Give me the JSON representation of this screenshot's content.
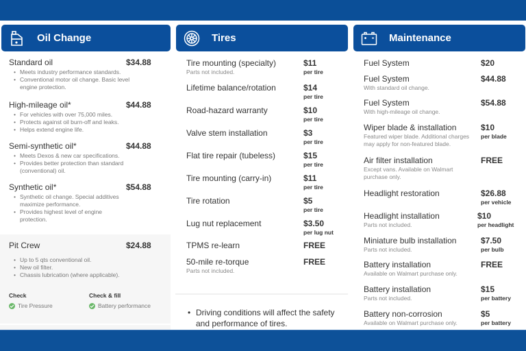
{
  "colors": {
    "brand": "#0b4f9c",
    "check": "#6bb86a"
  },
  "oil": {
    "title": "Oil Change",
    "icon": "oil-can-icon",
    "items": [
      {
        "name": "Standard oil",
        "price": "$34.88",
        "bullets": [
          "Meets industry performance standards.",
          "Conventional motor oil change. Basic level engine protection."
        ]
      },
      {
        "name": "High-mileage oil*",
        "price": "$44.88",
        "bullets": [
          "For vehicles with over 75,000 miles.",
          "Protects against oil burn-off and leaks.",
          "Helps extend engine life."
        ]
      },
      {
        "name": "Semi-synthetic oil*",
        "price": "$44.88",
        "bullets": [
          "Meets Dexos & new car specifications.",
          "Provides better protection than standard (conventional) oil."
        ]
      },
      {
        "name": "Synthetic oil*",
        "price": "$54.88",
        "bullets": [
          "Synthetic oil change. Special additives maximize performance.",
          "Provides highest level of engine protection."
        ]
      }
    ],
    "pit_crew": {
      "name": "Pit Crew",
      "price": "$24.88",
      "bullets": [
        "Up to 5 qts conventional oil.",
        "New oil filter.",
        "Chassis lubrication (where applicable)."
      ],
      "check_title": "Check",
      "check_item": "Tire Pressure",
      "fill_title": "Check & fill",
      "fill_item": "Battery performance"
    }
  },
  "tires": {
    "title": "Tires",
    "icon": "tire-icon",
    "items": [
      {
        "name": "Tire mounting (specialty)",
        "note": "Parts not included.",
        "price": "$11",
        "unit": "per tire"
      },
      {
        "name": "Lifetime balance/rotation",
        "note": "",
        "price": "$14",
        "unit": "per tire"
      },
      {
        "name": "Road-hazard warranty",
        "note": "",
        "price": "$10",
        "unit": "per tire"
      },
      {
        "name": "Valve stem installation",
        "note": "",
        "price": "$3",
        "unit": "per tire"
      },
      {
        "name": "Flat tire repair (tubeless)",
        "note": "",
        "price": "$15",
        "unit": "per tire"
      },
      {
        "name": "Tire mounting (carry-in)",
        "note": "",
        "price": "$11",
        "unit": "per tire"
      },
      {
        "name": "Tire rotation",
        "note": "",
        "price": "$5",
        "unit": "per tire"
      },
      {
        "name": "Lug nut replacement",
        "note": "",
        "price": "$3.50",
        "unit": "per lug nut"
      },
      {
        "name": "TPMS re-learn",
        "note": "",
        "price": "FREE",
        "unit": ""
      },
      {
        "name": "50-mile re-torque",
        "note": "Parts not included.",
        "price": "FREE",
        "unit": ""
      }
    ],
    "footnote": "Driving conditions will affect the safety and performance of tires."
  },
  "maintenance": {
    "title": "Maintenance",
    "icon": "battery-icon",
    "items": [
      {
        "name": "Fuel System",
        "note": "",
        "price": "$20",
        "unit": ""
      },
      {
        "name": "Fuel System",
        "note": "With standard oil change.",
        "price": "$44.88",
        "unit": ""
      },
      {
        "name": "Fuel System",
        "note": "With high-mileage oil change.",
        "price": "$54.88",
        "unit": ""
      },
      {
        "name": "Wiper blade & installation",
        "note": "Featured wiper blade. Additional charges may apply for non-featured blade.",
        "price": "$10",
        "unit": "per blade"
      },
      {
        "name": "Air filter installation",
        "note": "Except vans. Available on Walmart purchase only.",
        "price": "FREE",
        "unit": ""
      },
      {
        "name": "Headlight restoration",
        "note": "",
        "price": "$26.88",
        "unit": "per vehicle"
      },
      {
        "name": "Headlight installation",
        "note": "Parts not included.",
        "price": "$10",
        "unit": "per headlight"
      },
      {
        "name": "Miniature bulb installation",
        "note": "Parts not included.",
        "price": "$7.50",
        "unit": "per bulb"
      },
      {
        "name": "Battery installation",
        "note": "Available on Walmart purchase only.",
        "price": "FREE",
        "unit": ""
      },
      {
        "name": "Battery installation",
        "note": "Parts not included.",
        "price": "$15",
        "unit": "per battery"
      },
      {
        "name": "Battery non-corrosion",
        "note": "Available on Walmart purchase only.",
        "price": "$5",
        "unit": "per battery"
      }
    ]
  }
}
